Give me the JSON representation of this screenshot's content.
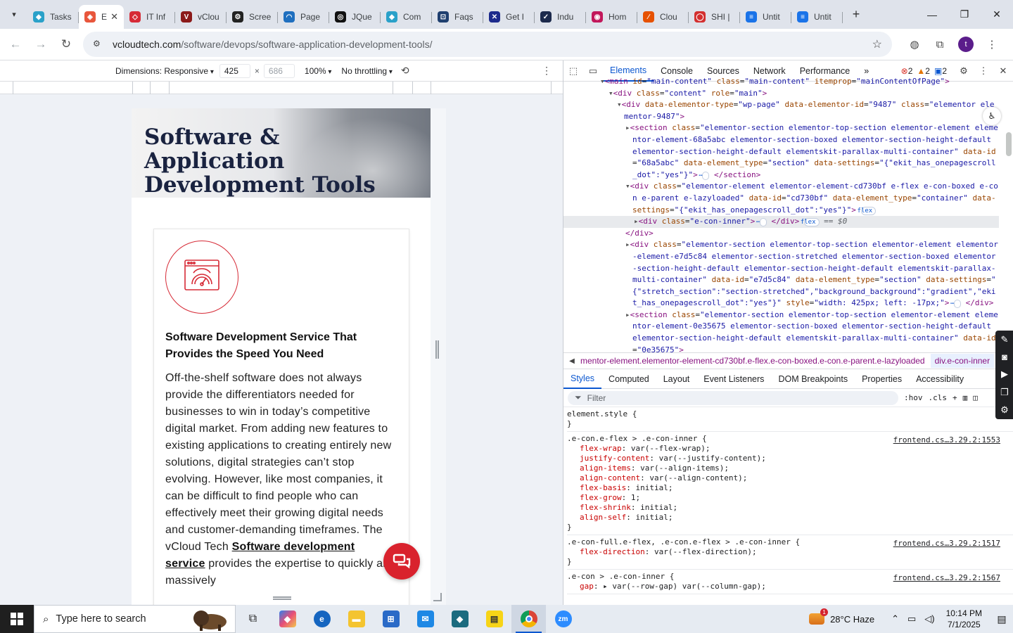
{
  "browser": {
    "tabs": [
      {
        "label": "Tasks",
        "color": "#2aa1c9",
        "glyph": "◆"
      },
      {
        "label": "E",
        "color": "#e8563c",
        "glyph": "◈",
        "active": true
      },
      {
        "label": "IT Inf",
        "color": "#d62a36",
        "glyph": "◇"
      },
      {
        "label": "vClou",
        "color": "#8b1a1a",
        "glyph": "V"
      },
      {
        "label": "Scree",
        "color": "#222222",
        "glyph": "⚙"
      },
      {
        "label": "Page",
        "color": "#1f6fbf",
        "glyph": "◠"
      },
      {
        "label": "JQue",
        "color": "#111111",
        "glyph": "◎"
      },
      {
        "label": "Com",
        "color": "#2aa1c9",
        "glyph": "◆"
      },
      {
        "label": "Faqs",
        "color": "#1f3f6f",
        "glyph": "⊡"
      },
      {
        "label": "Get I",
        "color": "#1c2a8c",
        "glyph": "✕"
      },
      {
        "label": "Indu",
        "color": "#1c2a4c",
        "glyph": "✓"
      },
      {
        "label": "Hom",
        "color": "#c2185b",
        "glyph": "◉"
      },
      {
        "label": "Clou",
        "color": "#e65100",
        "glyph": "∕"
      },
      {
        "label": "SHI |",
        "color": "#d32f2f",
        "glyph": "◯"
      },
      {
        "label": "Untit",
        "color": "#1a73e8",
        "glyph": "≡"
      },
      {
        "label": "Untit",
        "color": "#1a73e8",
        "glyph": "≡"
      }
    ],
    "url_host": "vcloudtech.com",
    "url_path": "/software/devops/software-application-development-tools/",
    "profile_initial": "t"
  },
  "device_toolbar": {
    "dimensions_label": "Dimensions: Responsive",
    "width": "425",
    "times": "×",
    "height": "686",
    "zoom": "100%",
    "throttling": "No throttling"
  },
  "page": {
    "hero_title": "Software & Application Development Tools",
    "card_heading": "Software Development Service That Provides the Speed You Need",
    "card_body_before": "Off-the-shelf software does not always provide the differentiators needed for businesses to win in today’s competitive digital market. From adding new features to existing applications to creating entirely new solutions, digital strategies can’t stop evolving. However, like most companies, it can be difficult to find people who can effectively meet their growing digital needs and customer-demanding timeframes. The vCloud Tech ",
    "card_link": "Software development service",
    "card_body_after": " provides the expertise to quickly and massively"
  },
  "devtools": {
    "tabs": [
      "Elements",
      "Console",
      "Sources",
      "Network",
      "Performance"
    ],
    "errors": "2",
    "warnings": "2",
    "issues": "2",
    "dom_lines": [
      {
        "indent": 4,
        "html": "<span class='tri'>▾</span><span class='tag'>&lt;main</span> <span class='attr'>id</span>=<span class='val'>\"main-content\"</span> <span class='attr'>class</span>=<span class='val'>\"main-content\"</span> <span class='attr'>itemprop</span>=<span class='val'>\"mainContentOfPage\"</span><span class='tag'>&gt;</span>"
      },
      {
        "indent": 5,
        "html": "<span class='tri'>▾</span><span class='tag'>&lt;div</span> <span class='attr'>class</span>=<span class='val'>\"content\"</span> <span class='attr'>role</span>=<span class='val'>\"main\"</span><span class='tag'>&gt;</span>"
      },
      {
        "indent": 6,
        "html": "<span class='tri'>▾</span><span class='tag'>&lt;div</span> <span class='attr'>data-elementor-type</span>=<span class='val'>\"wp-page\"</span> <span class='attr'>data-elementor-id</span>=<span class='val'>\"9487\"</span> <span class='attr'>class</span>=<span class='val'>\"elementor elementor-9487\"</span><span class='tag'>&gt;</span>"
      },
      {
        "indent": 7,
        "html": "<span class='tri'>▸</span><span class='tag'>&lt;section</span> <span class='attr'>class</span>=<span class='val'>\"elementor-section elementor-top-section elementor-element elementor-element-68a5abc elementor-section-boxed elementor-section-height-default elementor-section-height-default elementskit-parallax-multi-container\"</span> <span class='attr'>data-id</span>=<span class='val'>\"68a5abc\"</span> <span class='attr'>data-element_type</span>=<span class='val'>\"section\"</span> <span class='attr'>data-settings</span>=<span class='val'>\"{\"ekit_has_onepagescroll_dot\":\"yes\"}\"</span><span class='tag'>&gt;</span> <span class='pill'>⋯</span> <span class='tag'>&lt;/section&gt;</span>"
      },
      {
        "indent": 7,
        "html": "<span class='tri'>▾</span><span class='tag'>&lt;div</span> <span class='attr'>class</span>=<span class='val'>\"elementor-element elementor-element-cd730bf e-flex e-con-boxed e-con e-parent e-lazyloaded\"</span> <span class='attr'>data-id</span>=<span class='val'>\"cd730bf\"</span> <span class='attr'>data-element_type</span>=<span class='val'>\"container\"</span> <span class='attr'>data-settings</span>=<span class='val'>\"{\"ekit_has_onepagescroll_dot\":\"yes\"}\"</span><span class='tag'>&gt;</span> <span class='pill'>flex</span>"
      },
      {
        "indent": 8,
        "sel": true,
        "html": "<span class='tri'>▸</span><span class='tag'>&lt;div</span> <span class='attr'>class</span>=<span class='val'>\"e-con-inner\"</span><span class='tag'>&gt;</span> <span class='pill'>⋯</span> <span class='tag'>&lt;/div&gt;</span> <span class='pill'>flex</span> <span class='eq'>== $0</span>"
      },
      {
        "indent": 7,
        "html": "<span class='tag'>&lt;/div&gt;</span>"
      },
      {
        "indent": 7,
        "html": "<span class='tri'>▸</span><span class='tag'>&lt;div</span> <span class='attr'>class</span>=<span class='val'>\"elementor-section elementor-top-section elementor-element elementor-element-e7d5c84 elementor-section-stretched elementor-section-boxed elementor-section-height-default elementor-section-height-default elementskit-parallax-multi-container\"</span> <span class='attr'>data-id</span>=<span class='val'>\"e7d5c84\"</span> <span class='attr'>data-element_type</span>=<span class='val'>\"section\"</span> <span class='attr'>data-settings</span>=<span class='val'>\"{\"stretch_section\":\"section-stretched\",\"background_background\":\"gradient\",\"ekit_has_onepagescroll_dot\":\"yes\"}\"</span> <span class='attr'>style</span>=<span class='val'>\"width: 425px; left: -17px;\"</span><span class='tag'>&gt;</span> <span class='pill'>⋯</span> <span class='tag'>&lt;/div&gt;</span>"
      },
      {
        "indent": 7,
        "html": "<span class='tri'>▸</span><span class='tag'>&lt;section</span> <span class='attr'>class</span>=<span class='val'>\"elementor-section elementor-top-section elementor-element elementor-element-0e35675 elementor-section-boxed elementor-section-height-default elementor-section-height-default elementskit-parallax-multi-container\"</span> <span class='attr'>data-id</span>=<span class='val'>\"0e35675\"</span><span class='tag'>&gt;</span>"
      }
    ],
    "breadcrumb": "mentor-element.elementor-element-cd730bf.e-flex.e-con-boxed.e-con.e-parent.e-lazyloaded",
    "breadcrumb_current": "div.e-con-inner",
    "subtabs": [
      "Styles",
      "Computed",
      "Layout",
      "Event Listeners",
      "DOM Breakpoints",
      "Properties",
      "Accessibility"
    ],
    "filter_placeholder": "Filter",
    "hov": ":hov",
    "cls": ".cls",
    "rules": [
      {
        "selector": "element.style {",
        "source": "",
        "decls": [],
        "close": "}"
      },
      {
        "selector": ".e-con.e-flex > .e-con-inner {",
        "source": "frontend.cs…3.29.2:1553",
        "close": "}",
        "decls": [
          [
            "flex-wrap",
            "var(--flex-wrap);"
          ],
          [
            "justify-content",
            "var(--justify-content);"
          ],
          [
            "align-items",
            "var(--align-items);"
          ],
          [
            "align-content",
            "var(--align-content);"
          ],
          [
            "flex-basis",
            "initial;"
          ],
          [
            "flex-grow",
            "1;"
          ],
          [
            "flex-shrink",
            "initial;"
          ],
          [
            "align-self",
            "initial;"
          ]
        ]
      },
      {
        "selector": ".e-con-full.e-flex, .e-con.e-flex > .e-con-inner {",
        "source": "frontend.cs…3.29.2:1517",
        "close": "}",
        "decls": [
          [
            "flex-direction",
            "var(--flex-direction);"
          ]
        ]
      },
      {
        "selector": ".e-con > .e-con-inner {",
        "source": "frontend.cs…3.29.2:1567",
        "close": "",
        "decls": [
          [
            "gap",
            "▸ var(--row-gap) var(--column-gap);"
          ]
        ]
      }
    ]
  },
  "taskbar": {
    "search_placeholder": "Type here to search",
    "weather": "28°C  Haze",
    "time": "10:14 PM",
    "date": "7/1/2025"
  }
}
